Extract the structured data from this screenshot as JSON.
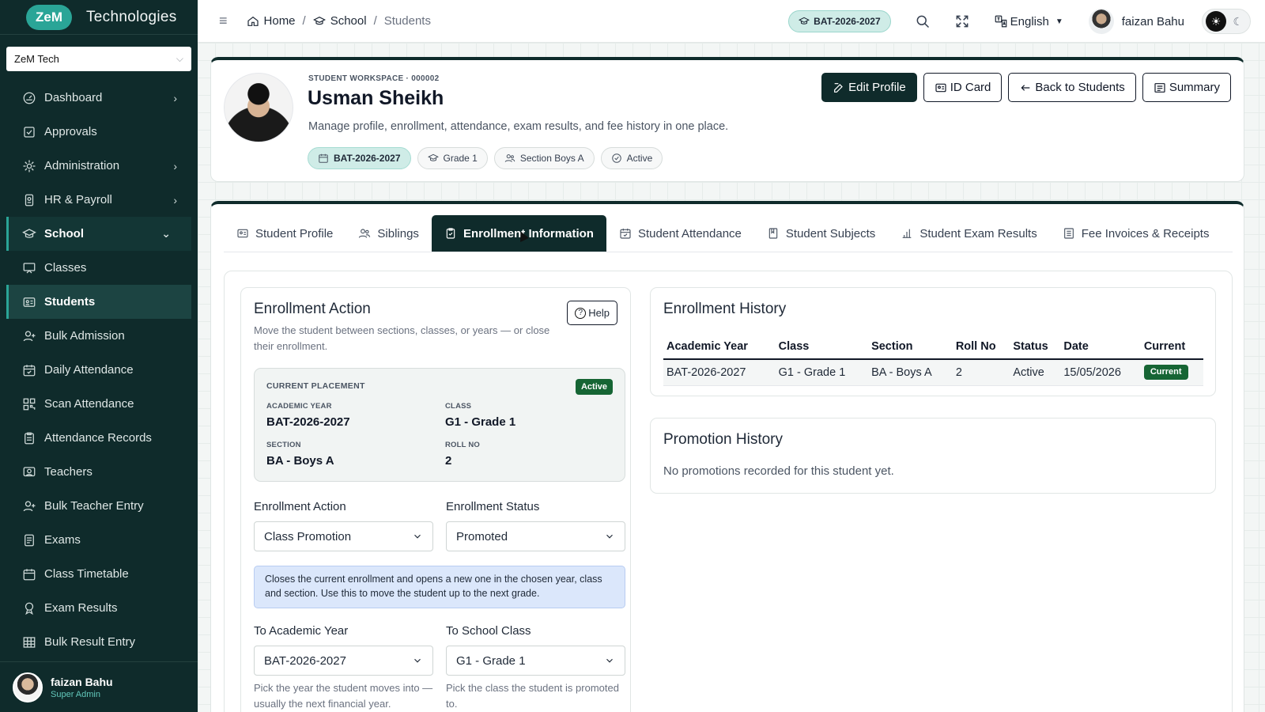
{
  "brand": {
    "short": "ZeM",
    "name": "Technologies"
  },
  "org_select": {
    "value": "ZeM Tech"
  },
  "sidebar": {
    "items": [
      {
        "label": "Dashboard",
        "icon": "dashboard-icon",
        "has_arrow": true
      },
      {
        "label": "Approvals",
        "icon": "check-square-icon"
      },
      {
        "label": "Administration",
        "icon": "gear-icon",
        "has_arrow": true
      },
      {
        "label": "HR & Payroll",
        "icon": "id-badge-icon",
        "has_arrow": true
      },
      {
        "label": "School",
        "icon": "graduation-cap-icon",
        "expanded": true
      },
      {
        "label": "Classes",
        "icon": "presentation-icon"
      },
      {
        "label": "Students",
        "icon": "id-card-icon",
        "active": true
      },
      {
        "label": "Bulk Admission",
        "icon": "user-plus-icon"
      },
      {
        "label": "Daily Attendance",
        "icon": "calendar-check-icon"
      },
      {
        "label": "Scan Attendance",
        "icon": "qr-code-icon"
      },
      {
        "label": "Attendance Records",
        "icon": "clipboard-icon"
      },
      {
        "label": "Teachers",
        "icon": "teacher-icon"
      },
      {
        "label": "Bulk Teacher Entry",
        "icon": "user-plus-icon"
      },
      {
        "label": "Exams",
        "icon": "exam-icon"
      },
      {
        "label": "Class Timetable",
        "icon": "calendar-icon"
      },
      {
        "label": "Exam Results",
        "icon": "award-icon"
      },
      {
        "label": "Bulk Result Entry",
        "icon": "grid-icon"
      }
    ],
    "user": {
      "name": "faizan Bahu",
      "role": "Super Admin"
    }
  },
  "topbar": {
    "breadcrumb": {
      "home": "Home",
      "school": "School",
      "current": "Students"
    },
    "academic_year": "BAT-2026-2027",
    "language": "English",
    "user_name": "faizan Bahu"
  },
  "header": {
    "workspace_label": "STUDENT WORKSPACE · 000002",
    "student_name": "Usman Sheikh",
    "tagline": "Manage profile, enrollment, attendance, exam results, and fee history in one place.",
    "chips": {
      "year": "BAT-2026-2027",
      "grade": "Grade 1",
      "section": "Section Boys A",
      "status": "Active"
    },
    "actions": {
      "edit": "Edit Profile",
      "id_card": "ID Card",
      "back": "Back to Students",
      "summary": "Summary"
    }
  },
  "tabs": [
    {
      "label": "Student Profile",
      "icon": "id-card-icon"
    },
    {
      "label": "Siblings",
      "icon": "users-icon"
    },
    {
      "label": "Enrollment Information",
      "icon": "clipboard-check-icon",
      "active": true
    },
    {
      "label": "Student Attendance",
      "icon": "calendar-check-icon"
    },
    {
      "label": "Student Subjects",
      "icon": "book-icon"
    },
    {
      "label": "Student Exam Results",
      "icon": "bar-chart-icon"
    },
    {
      "label": "Fee Invoices & Receipts",
      "icon": "receipt-icon"
    }
  ],
  "enrollment": {
    "title": "Enrollment Action",
    "description": "Move the student between sections, classes, or years — or close their enrollment.",
    "help": "Help",
    "placement": {
      "title": "CURRENT PLACEMENT",
      "badge": "Active",
      "academic_year_label": "ACADEMIC YEAR",
      "academic_year": "BAT-2026-2027",
      "class_label": "CLASS",
      "class": "G1 - Grade 1",
      "section_label": "SECTION",
      "section": "BA - Boys A",
      "roll_label": "ROLL NO",
      "roll": "2"
    },
    "action_label": "Enrollment Action",
    "action_value": "Class Promotion",
    "status_label": "Enrollment Status",
    "status_value": "Promoted",
    "info": "Closes the current enrollment and opens a new one in the chosen year, class and section. Use this to move the student up to the next grade.",
    "to_year_label": "To Academic Year",
    "to_year_value": "BAT-2026-2027",
    "to_class_label": "To School Class",
    "to_class_value": "G1 - Grade 1",
    "to_year_hint": "Pick the year the student moves into — usually the next financial year.",
    "to_class_hint": "Pick the class the student is promoted to."
  },
  "history": {
    "title": "Enrollment History",
    "columns": [
      "Academic Year",
      "Class",
      "Section",
      "Roll No",
      "Status",
      "Date",
      "Current"
    ],
    "rows": [
      {
        "year": "BAT-2026-2027",
        "class": "G1 - Grade 1",
        "section": "BA - Boys A",
        "roll": "2",
        "status": "Active",
        "date": "15/05/2026",
        "current": "Current"
      }
    ]
  },
  "promotion": {
    "title": "Promotion History",
    "empty": "No promotions recorded for this student yet."
  },
  "colors": {
    "sidebar_bg": "#0f2b2b",
    "accent": "#2aa597",
    "success": "#166534",
    "info_bg": "#dbe7fb"
  }
}
